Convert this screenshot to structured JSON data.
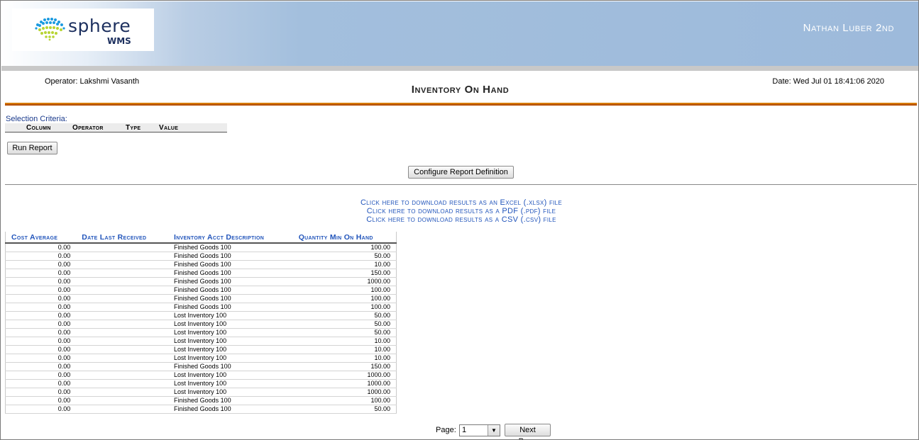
{
  "header": {
    "logo_word": "sphere",
    "logo_sub": "WMS",
    "user_name": "Nathan Luber 2nd"
  },
  "report": {
    "operator": "Operator: Lakshmi Vasanth",
    "title": "Inventory On Hand",
    "date": "Date: Wed Jul 01 18:41:06 2020"
  },
  "criteria": {
    "label": "Selection Criteria:",
    "columns": [
      "Column",
      "Operator",
      "Type",
      "Value"
    ]
  },
  "buttons": {
    "run_report": "Run Report",
    "configure": "Configure Report Definition",
    "next_page": "Next Page"
  },
  "downloads": {
    "excel": "Click here to download results as an Excel (.xlsx) file",
    "pdf": "Click here to download results as a PDF (.pdf) file",
    "csv": "Click here to download results as a CSV (.csv) file"
  },
  "table": {
    "headers": [
      "Cost Average",
      "Date Last Received",
      "Inventory Acct Description",
      "Quantity Min On Hand"
    ],
    "rows": [
      [
        "0.00",
        "",
        "Finished Goods 100",
        "100.00"
      ],
      [
        "0.00",
        "",
        "Finished Goods 100",
        "50.00"
      ],
      [
        "0.00",
        "",
        "Finished Goods 100",
        "10.00"
      ],
      [
        "0.00",
        "",
        "Finished Goods 100",
        "150.00"
      ],
      [
        "0.00",
        "",
        "Finished Goods 100",
        "1000.00"
      ],
      [
        "0.00",
        "",
        "Finished Goods 100",
        "100.00"
      ],
      [
        "0.00",
        "",
        "Finished Goods 100",
        "100.00"
      ],
      [
        "0.00",
        "",
        "Finished Goods 100",
        "100.00"
      ],
      [
        "0.00",
        "",
        "Lost Inventory 100",
        "50.00"
      ],
      [
        "0.00",
        "",
        "Lost Inventory 100",
        "50.00"
      ],
      [
        "0.00",
        "",
        "Lost Inventory 100",
        "50.00"
      ],
      [
        "0.00",
        "",
        "Lost Inventory 100",
        "10.00"
      ],
      [
        "0.00",
        "",
        "Lost Inventory 100",
        "10.00"
      ],
      [
        "0.00",
        "",
        "Lost Inventory 100",
        "10.00"
      ],
      [
        "0.00",
        "",
        "Finished Goods 100",
        "150.00"
      ],
      [
        "0.00",
        "",
        "Lost Inventory 100",
        "1000.00"
      ],
      [
        "0.00",
        "",
        "Lost Inventory 100",
        "1000.00"
      ],
      [
        "0.00",
        "",
        "Lost Inventory 100",
        "1000.00"
      ],
      [
        "0.00",
        "",
        "Finished Goods 100",
        "100.00"
      ],
      [
        "0.00",
        "",
        "Finished Goods 100",
        "50.00"
      ]
    ]
  },
  "pager": {
    "label": "Page:",
    "current": "1"
  }
}
